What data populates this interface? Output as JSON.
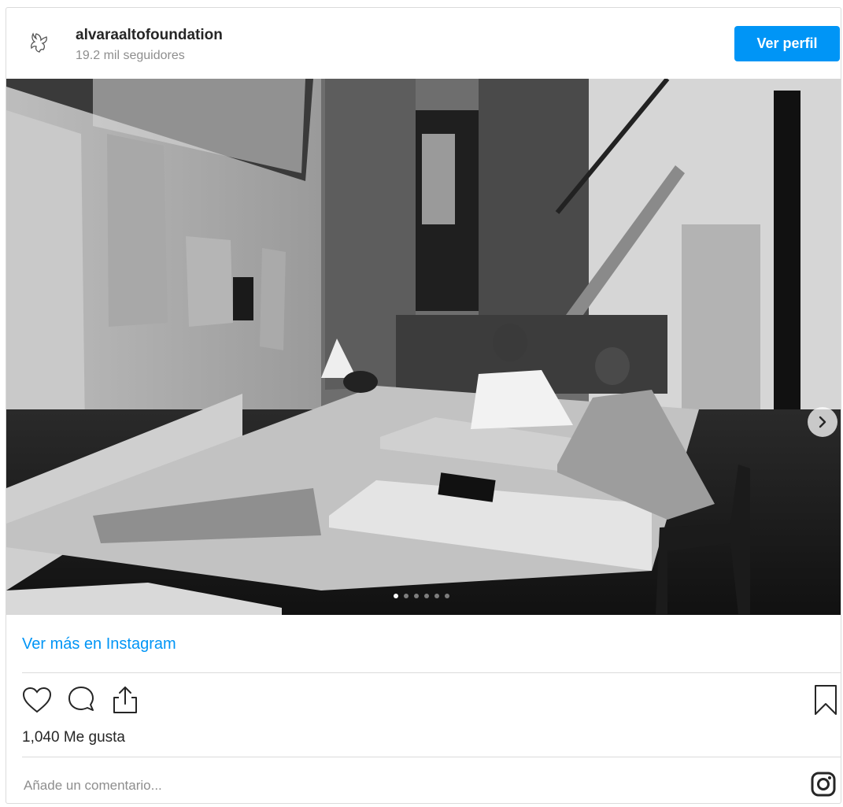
{
  "header": {
    "username": "alvaraaltofoundation",
    "followers": "19.2 mil seguidores",
    "profile_button": "Ver perfil",
    "avatar_icon": "bird-logo-icon"
  },
  "media": {
    "carousel": {
      "slide_count": 6,
      "active_index": 0
    },
    "next_icon": "chevron-right-icon"
  },
  "links": {
    "see_more": "Ver más en Instagram"
  },
  "actions": {
    "icons": [
      "heart-icon",
      "comment-icon",
      "share-icon"
    ],
    "bookmark_icon": "bookmark-icon"
  },
  "likes": {
    "text": "1,040 Me gusta"
  },
  "comment": {
    "placeholder": "Añade un comentario..."
  },
  "footer": {
    "logo_icon": "instagram-logo-icon"
  },
  "colors": {
    "accent": "#0095f6",
    "text": "#262626",
    "muted": "#8e8e8e",
    "border": "#dbdbdb"
  }
}
